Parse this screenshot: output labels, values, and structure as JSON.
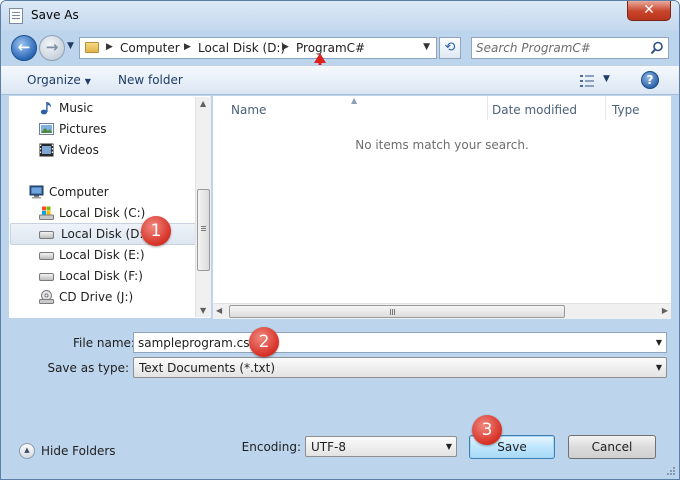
{
  "window": {
    "title": "Save As",
    "close_glyph": "✕"
  },
  "nav": {
    "back_glyph": "←",
    "forward_glyph": "→",
    "breadcrumb": [
      "Computer",
      "Local Disk (D:)",
      "ProgramC#"
    ],
    "search_placeholder": "Search ProgramC#",
    "refresh_glyph": "⟲"
  },
  "toolbar": {
    "organize_label": "Organize",
    "new_folder_label": "New folder",
    "help_glyph": "?"
  },
  "sidebar": {
    "items": [
      {
        "label": "Music",
        "icon": "music-icon"
      },
      {
        "label": "Pictures",
        "icon": "pictures-icon"
      },
      {
        "label": "Videos",
        "icon": "videos-icon"
      },
      {
        "label": "Computer",
        "icon": "computer-icon"
      },
      {
        "label": "Local Disk (C:)",
        "icon": "system-drive-icon"
      },
      {
        "label": "Local Disk (D:)",
        "icon": "drive-icon",
        "selected": true
      },
      {
        "label": "Local Disk (E:)",
        "icon": "drive-icon"
      },
      {
        "label": "Local Disk (F:)",
        "icon": "drive-icon"
      },
      {
        "label": "CD Drive (J:)",
        "icon": "cd-drive-icon"
      }
    ]
  },
  "filelist": {
    "columns": [
      "Name",
      "Date modified",
      "Type"
    ],
    "empty_message": "No items match your search."
  },
  "form": {
    "file_name_label": "File name:",
    "file_name_value": "sampleprogram.cs",
    "save_type_label": "Save as type:",
    "save_type_value": "Text Documents (*.txt)",
    "encoding_label": "Encoding:",
    "encoding_value": "UTF-8"
  },
  "footer": {
    "hide_folders_label": "Hide Folders",
    "save_label": "Save",
    "cancel_label": "Cancel"
  },
  "annotations": {
    "badge_1": "1",
    "badge_2": "2",
    "badge_3": "3"
  },
  "colors": {
    "accent": "#2a67b7",
    "badge": "#d8352a",
    "arrow": "#e0201a"
  }
}
